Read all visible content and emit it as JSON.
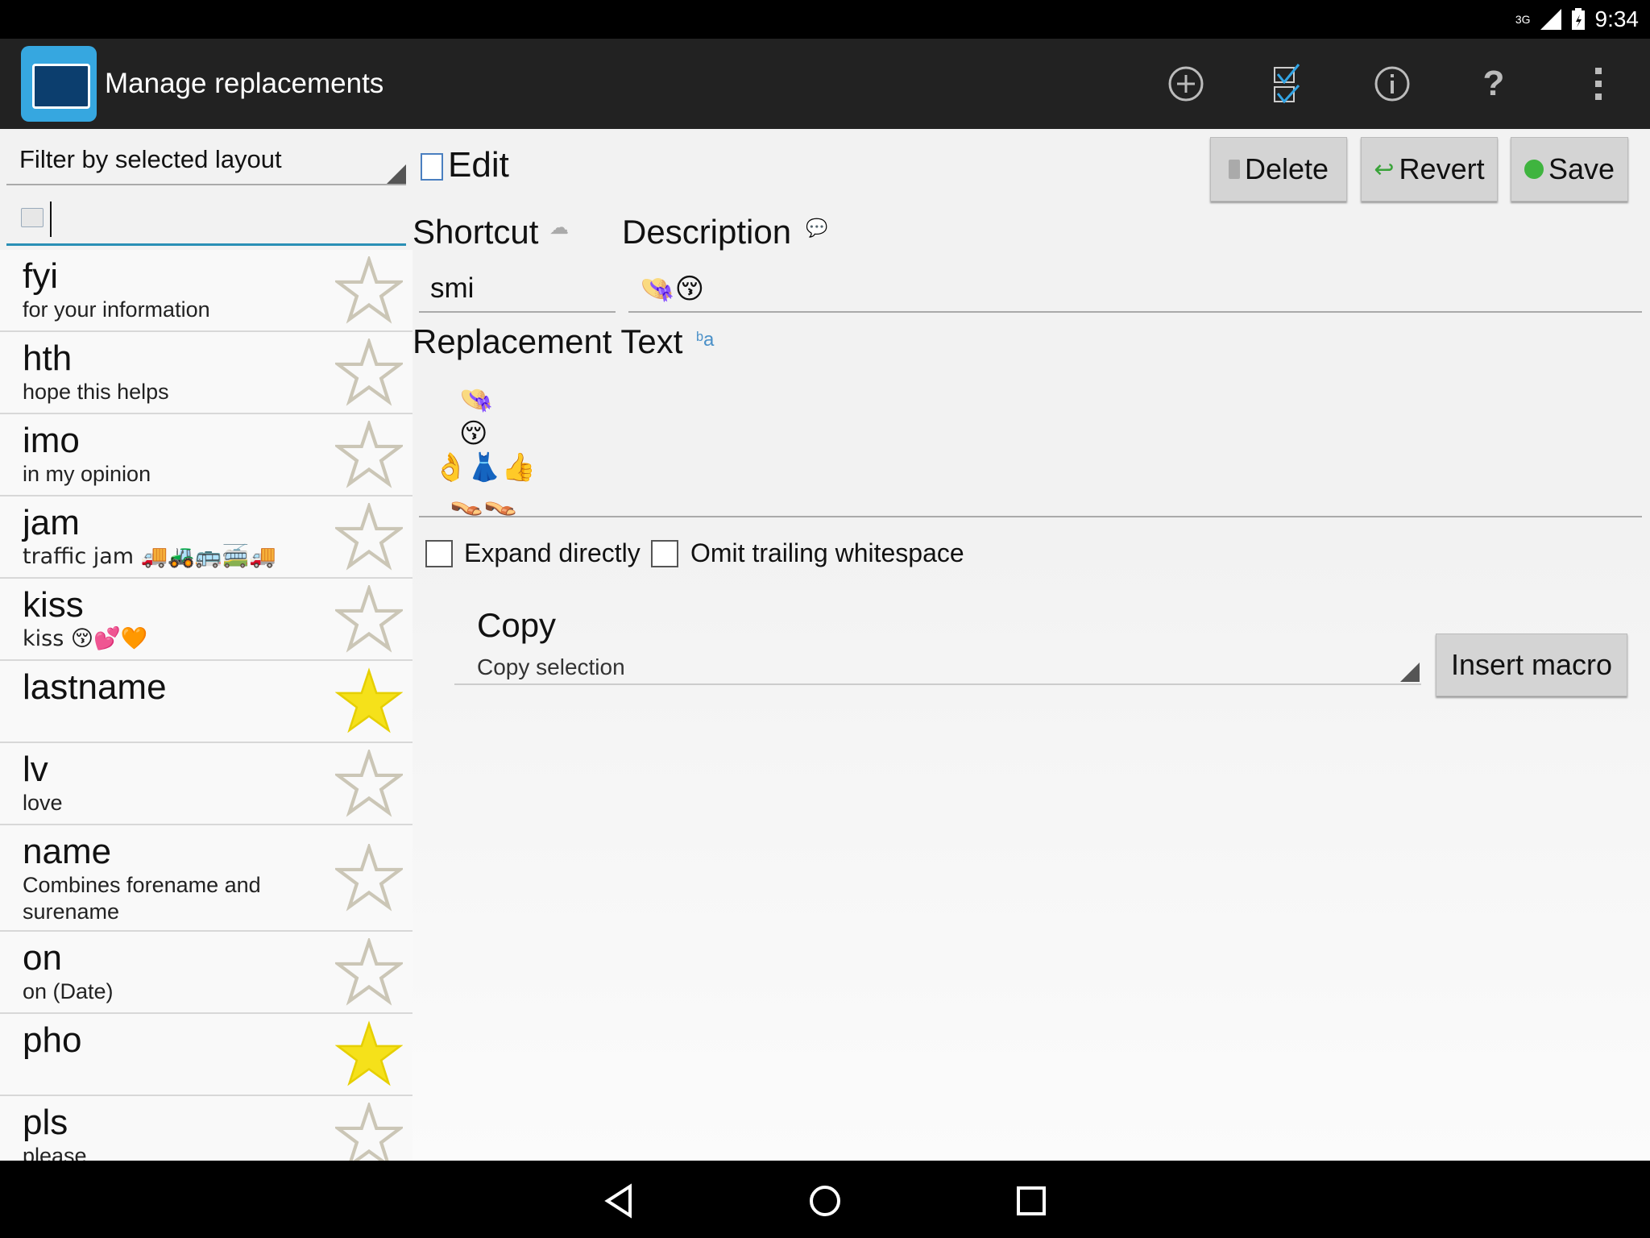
{
  "status": {
    "network": "3G",
    "time": "9:34"
  },
  "header": {
    "title": "Manage replacements",
    "actions": [
      {
        "name": "add-icon",
        "glyph": "⊕"
      },
      {
        "name": "select-all-icon",
        "glyph": "☑"
      },
      {
        "name": "info-icon",
        "glyph": "ⓘ"
      },
      {
        "name": "help-icon",
        "glyph": "?"
      },
      {
        "name": "overflow-menu-icon",
        "glyph": "⋮"
      }
    ]
  },
  "filter": {
    "label": "Filter by selected layout"
  },
  "search": {
    "value": ""
  },
  "list": {
    "items": [
      {
        "shortcut": "fyi",
        "description": "for your information",
        "starred": false
      },
      {
        "shortcut": "hth",
        "description": "hope this helps",
        "starred": false
      },
      {
        "shortcut": "imo",
        "description": "in my opinion",
        "starred": false
      },
      {
        "shortcut": "jam",
        "description": "traffic jam 🚚🚜🚌🚎🚚🚙",
        "starred": false
      },
      {
        "shortcut": "kiss",
        "description": "kiss 😚💕🧡",
        "starred": false
      },
      {
        "shortcut": "lastname",
        "description": "",
        "starred": true
      },
      {
        "shortcut": "lv",
        "description": "love",
        "starred": false
      },
      {
        "shortcut": "name",
        "description": "Combines forename and surename",
        "starred": false
      },
      {
        "shortcut": "on",
        "description": "on (Date)",
        "starred": false
      },
      {
        "shortcut": "pho",
        "description": "",
        "starred": true
      },
      {
        "shortcut": "pls",
        "description": "please",
        "starred": false
      }
    ]
  },
  "editor": {
    "title": "Edit",
    "buttons": {
      "delete": "Delete",
      "revert": "Revert",
      "save": "Save"
    },
    "shortcut_label": "Shortcut",
    "shortcut_value": "smi",
    "description_label": "Description",
    "description_value": "👒😚",
    "replacement_label": "Replacement Text",
    "replacement_lines": [
      "👒",
      "😚",
      "👌👗👍",
      "👡👡"
    ],
    "expand_directly": "Expand directly",
    "omit_whitespace": "Omit trailing whitespace",
    "macro_title": "Copy",
    "macro_subtitle": "Copy selection",
    "insert_macro": "Insert macro"
  },
  "colors": {
    "accent": "#2a8fb5",
    "star_active": "#f5e11a",
    "action_bar": "#222222"
  }
}
